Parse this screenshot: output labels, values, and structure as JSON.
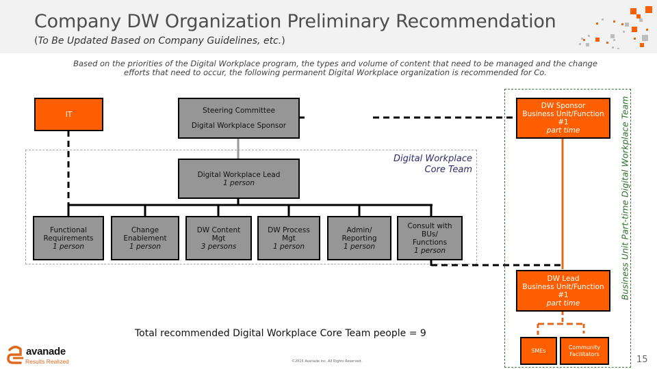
{
  "header": {
    "title": "Company DW Organization Preliminary Recommendation",
    "subtitle_open": "(",
    "subtitle_italic": "To Be Updated Based on Company Guidelines, etc.",
    "subtitle_close": ")"
  },
  "intro": {
    "line1": "Based on the priorities of the Digital Workplace program, the types and volume of content that need to be managed and the change",
    "line2": "efforts that need to occur, the following permanent Digital Workplace organization is recommended for Co."
  },
  "colors": {
    "accent_orange": "#ff5f00",
    "box_grey": "#969696",
    "core_label": "#2b2b6b",
    "bu_label": "#2f6f2f",
    "connector_orange": "#e0681c"
  },
  "org": {
    "it": {
      "title": "IT"
    },
    "steering": {
      "line1": "Steering Committee",
      "line2": "Digital Workplace Sponsor"
    },
    "lead": {
      "title": "Digital Workplace Lead",
      "sub": "1 person"
    },
    "core_team_label": {
      "line1": "Digital Workplace",
      "line2": "Core Team"
    },
    "roles": [
      {
        "line1": "Functional",
        "line2": "Requirements",
        "sub": "1 person"
      },
      {
        "line1": "Change",
        "line2": "Enablement",
        "sub": "1 person"
      },
      {
        "line1": "DW Content",
        "line2": "Mgt",
        "sub": "3 persons"
      },
      {
        "line1": "DW Process",
        "line2": "Mgt",
        "sub": "1 person"
      },
      {
        "line1": "Admin/",
        "line2": "Reporting",
        "sub": "1 person"
      },
      {
        "line1": "Consult with BUs/",
        "line2": "Functions",
        "sub": "1 person"
      }
    ],
    "bu_sponsor": {
      "line1": "DW Sponsor",
      "line2": "Business Unit/Function #1",
      "sub": "part time"
    },
    "bu_lead": {
      "line1": "DW Lead",
      "line2": "Business Unit/Function #1",
      "sub": "part time"
    },
    "smes": {
      "title": "SMEs"
    },
    "facilitators": {
      "line1": "Community",
      "line2": "Facilitators"
    },
    "bu_team_label": "Business Unit Part-time Digital Workplace Team"
  },
  "footer": {
    "total": "Total recommended Digital Workplace Core Team people = 9",
    "copyright": "©2015 Avanade Inc. All Rights Reserved.",
    "page_number": "15",
    "logo_word": "avanade",
    "logo_tagline": "Results Realized"
  }
}
